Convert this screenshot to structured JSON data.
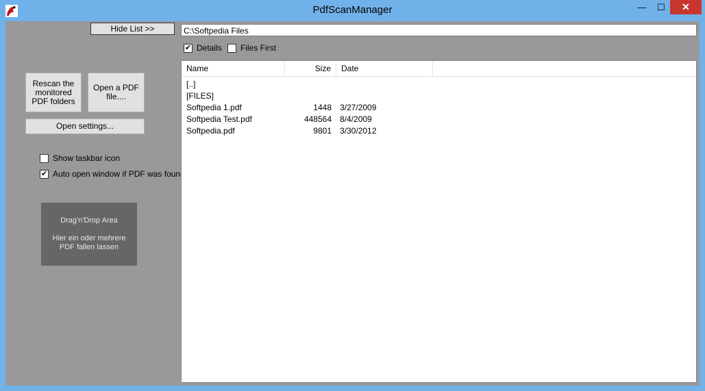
{
  "window": {
    "title": "PdfScanManager",
    "min_glyph": "—",
    "max_glyph": "☐",
    "close_glyph": "✕"
  },
  "toolbar": {
    "hide_list_label": "Hide List >>",
    "path_value": "C:\\Softpedia Files"
  },
  "options": {
    "details_label": "Details",
    "details_checked": true,
    "files_first_label": "Files First",
    "files_first_checked": false
  },
  "left": {
    "rescan_label": "Rescan the monitored PDF folders",
    "open_pdf_label": "Open a PDF file....",
    "settings_label": "Open settings...",
    "show_taskbar_label": "Show taskbar icon",
    "show_taskbar_checked": false,
    "auto_open_label": "Auto open window if PDF was found",
    "auto_open_checked": true
  },
  "dropzone": {
    "title": "Drag'n'Drop Area",
    "text_line1": "Hier ein oder mehrere",
    "text_line2": "PDF fallen lassen"
  },
  "list": {
    "columns": [
      "Name",
      "Size",
      "Date"
    ],
    "rows": [
      {
        "name": "[..]",
        "size": "",
        "date": ""
      },
      {
        "name": "[FILES]",
        "size": "",
        "date": ""
      },
      {
        "name": "Softpedia 1.pdf",
        "size": "1448",
        "date": "3/27/2009"
      },
      {
        "name": "Softpedia Test.pdf",
        "size": "448564",
        "date": "8/4/2009"
      },
      {
        "name": "Softpedia.pdf",
        "size": "9801",
        "date": "3/30/2012"
      }
    ]
  },
  "check_glyph": "✔"
}
